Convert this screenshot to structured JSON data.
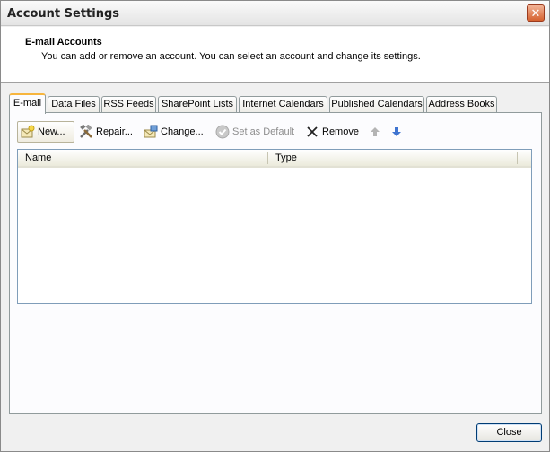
{
  "window": {
    "title": "Account Settings",
    "close_glyph": "✕"
  },
  "header": {
    "title": "E-mail Accounts",
    "description": "You can add or remove an account. You can select an account and change its settings."
  },
  "tabs": [
    {
      "label": "E-mail",
      "active": true
    },
    {
      "label": "Data Files",
      "active": false
    },
    {
      "label": "RSS Feeds",
      "active": false
    },
    {
      "label": "SharePoint Lists",
      "active": false
    },
    {
      "label": "Internet Calendars",
      "active": false
    },
    {
      "label": "Published Calendars",
      "active": false
    },
    {
      "label": "Address Books",
      "active": false
    }
  ],
  "toolbar": {
    "new_label": "New...",
    "repair_label": "Repair...",
    "change_label": "Change...",
    "set_default_label": "Set as Default",
    "remove_label": "Remove"
  },
  "list": {
    "columns": [
      "Name",
      "Type"
    ],
    "rows": []
  },
  "footer": {
    "close_label": "Close"
  },
  "icons": {
    "new": "new-account-icon",
    "repair": "repair-tools-icon",
    "change": "change-account-icon",
    "set_default": "checkmark-icon",
    "remove": "remove-x-icon",
    "move_up": "arrow-up-icon",
    "move_down": "arrow-down-icon"
  }
}
